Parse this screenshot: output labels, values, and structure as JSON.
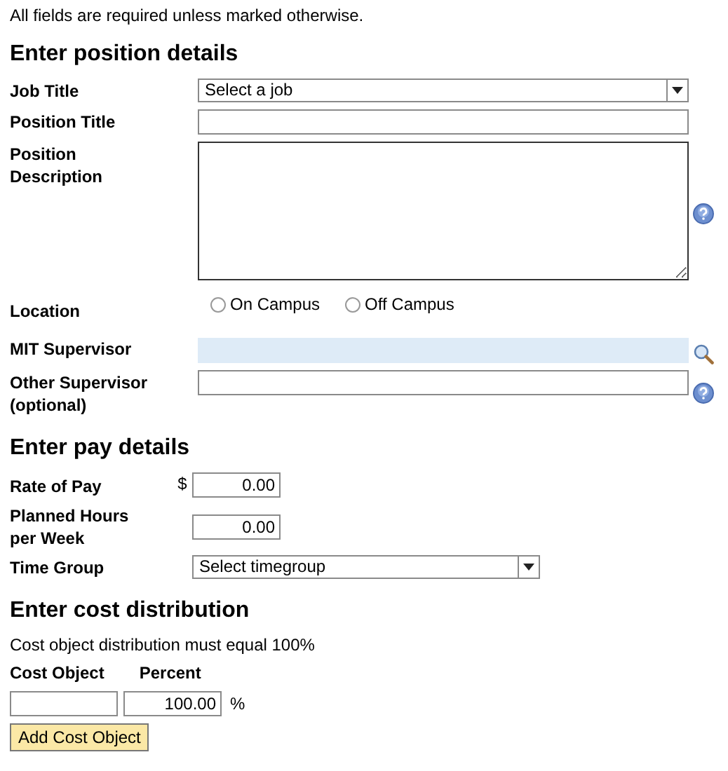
{
  "intro": "All fields are required unless marked otherwise.",
  "position": {
    "heading": "Enter position details",
    "fields": [
      {
        "kind": "select",
        "label": "Job Title",
        "value": "Select a job",
        "help": false
      },
      {
        "kind": "text",
        "label": "Position Title",
        "help": false
      },
      {
        "kind": "textarea",
        "label": "Position Description",
        "help": true
      },
      {
        "kind": "radio",
        "label": "Location",
        "options": [
          {
            "label": "On Campus",
            "selected": false
          },
          {
            "label": "Off Campus",
            "selected": false
          }
        ]
      },
      {
        "kind": "lookup",
        "label": "MIT Supervisor"
      },
      {
        "kind": "text",
        "label": "Other Supervisor (optional)",
        "help": true
      }
    ]
  },
  "pay": {
    "heading": "Enter pay details",
    "fields": [
      {
        "kind": "amount",
        "label": "Rate of Pay",
        "prefix": "$",
        "value": "0.00"
      },
      {
        "kind": "amount",
        "label": "Planned Hours per Week",
        "value": "0.00"
      },
      {
        "kind": "select",
        "label": "Time Group",
        "value": "Select timegroup"
      }
    ]
  },
  "cost": {
    "heading": "Enter cost distribution",
    "note": "Cost object distribution must equal 100%",
    "columns": [
      "Cost Object",
      "Percent"
    ],
    "row": {
      "percent": "100.00",
      "unit": "%"
    },
    "button": "Add Cost Object"
  }
}
